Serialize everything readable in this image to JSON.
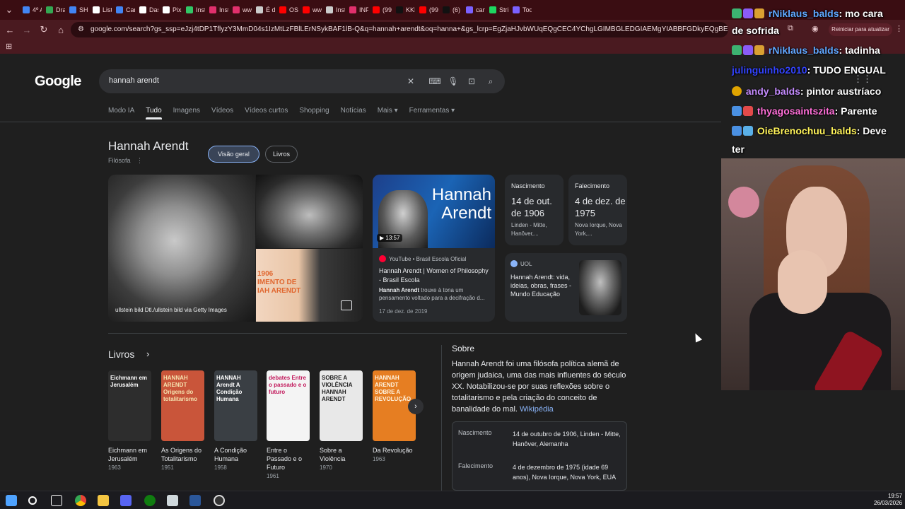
{
  "browser": {
    "tabs": [
      "4º A",
      "Dra",
      "SHI",
      "Listi",
      "Can",
      "Das",
      "Pix",
      "Inst",
      "Inst",
      "ww",
      "É di",
      "OS",
      "ww",
      "Inst",
      "INF",
      "(99",
      "KKI",
      "(99",
      "(6)",
      "can",
      "Stri",
      "Tod"
    ],
    "tab_colors": [
      "#4285f4",
      "#34a853",
      "#4285f4",
      "#ffffff",
      "#4285f4",
      "#ffffff",
      "#ffffff",
      "#32c766",
      "#e1306c",
      "#e1306c",
      "#cccccc",
      "#ff0000",
      "#ff0000",
      "#cccccc",
      "#e1306c",
      "#ff0000",
      "#111111",
      "#ff0000",
      "#111111",
      "#7b61ff",
      "#1ed760",
      "#7b61ff"
    ],
    "url": "google.com/search?gs_ssp=eJzj4tDP1TflyzY3MmD04s1IzMtLzFBlLErNSykBAF1lB-Q&q=hannah+arendt&oq=hanna+&gs_lcrp=EgZjaHJvbWUqEQgCEC4YChgLGIMBGLEDGIAEMgYIABBFGDkyEQgBEC4YChgLGIMBGLEDE...",
    "restart_label": "Reiniciar para atualizar"
  },
  "search": {
    "logo": "Google",
    "query": "hannah arendt",
    "tabs": [
      "Modo IA",
      "Tudo",
      "Imagens",
      "Vídeos",
      "Vídeos curtos",
      "Shopping",
      "Notícias",
      "Mais ▾",
      "Ferramentas ▾"
    ]
  },
  "knowledge_panel": {
    "title": "Hannah Arendt",
    "subtitle": "Filósofa",
    "chips": [
      "Visão geral",
      "Livros"
    ],
    "photo_credit": "ullstein bild Dtl./ullstein bild via Getty Images",
    "photo_overlay": "1906\nIMENTO DE\nIAH ARENDT",
    "video": {
      "thumb_text": "Hannah\nArendt",
      "duration": "▶ 13:57",
      "source": "YouTube • Brasil Escola Oficial",
      "title": "Hannah Arendt | Women of Philosophy - Brasil Escola",
      "desc_bold": "Hannah Arendt",
      "desc": " trouxe à tona um pensamento voltado para a decifração d...",
      "date": "17 de dez. de 2019"
    },
    "birth": {
      "label": "Nascimento",
      "date": "14 de out. de 1906",
      "place": "Linden - Mitte, Hanôver,..."
    },
    "death": {
      "label": "Falecimento",
      "date": "4 de dez. de 1975",
      "place": "Nova Iorque, Nova York,..."
    },
    "uol": {
      "source": "UOL",
      "title": "Hannah Arendt: vida, ideias, obras, frases - Mundo Educação"
    },
    "books_heading": "Livros",
    "books": [
      {
        "title": "Eichmann em Jerusalém",
        "year": "1963",
        "cover_text": "Eichmann em Jerusalém",
        "color": "#2d2d2d",
        "text_color": "#ffffff"
      },
      {
        "title": "As Origens do Totalitarismo",
        "year": "1951",
        "cover_text": "HANNAH ARENDT Origens do totalitarismo",
        "color": "#c9553a",
        "text_color": "#f5e3b0"
      },
      {
        "title": "A Condição Humana",
        "year": "1958",
        "cover_text": "HANNAH Arendt A Condição Humana",
        "color": "#3a3f44",
        "text_color": "#ffffff"
      },
      {
        "title": "Entre o Passado e o Futuro",
        "year": "1961",
        "cover_text": "debates Entre o passado e o futuro",
        "color": "#f4f4f4",
        "text_color": "#c2185b"
      },
      {
        "title": "Sobre a Violência",
        "year": "1970",
        "cover_text": "SOBRE A VIOLÊNCIA HANNAH ARENDT",
        "color": "#e8e8e8",
        "text_color": "#222222"
      },
      {
        "title": "Da Revolução",
        "year": "1963",
        "cover_text": "HANNAH ARENDT SOBRE A REVOLUÇÃO",
        "color": "#e67e22",
        "text_color": "#fff4e0"
      }
    ],
    "about_heading": "Sobre",
    "about_text": "Hannah Arendt foi uma filósofa política alemã de origem judaica, uma das mais influentes do século XX. Notabilizou-se por suas reflexões sobre o totalitarismo e pela criação do conceito de banalidade do mal. ",
    "about_link": "Wikipédia",
    "facts": [
      {
        "k": "Nascimento",
        "v": "14 de outubro de 1906, Linden - Mitte, Hanôver, Alemanha"
      },
      {
        "k": "Falecimento",
        "v": "4 de dezembro de 1975 (idade 69 anos), Nova Iorque, Nova York, EUA"
      }
    ]
  },
  "chat": [
    {
      "user": "rNiklaus_balds",
      "user_color": "#5fa8ff",
      "text": ": mo cara",
      "cont": "de sofrida"
    },
    {
      "user": "rNiklaus_balds",
      "user_color": "#5fa8ff",
      "text": ": tadinha",
      "cont": ""
    },
    {
      "user": "julinguinho2010",
      "user_color": "#3344ff",
      "text": ": TUDO ENGUAL",
      "cont": ""
    },
    {
      "user": "andy_balds",
      "user_color": "#c58cff",
      "text": ": pintor austríaco",
      "cont": ""
    },
    {
      "user": "thyagosaintszita",
      "user_color": "#ff6fd8",
      "text": ": Parente",
      "cont": ""
    },
    {
      "user": "OieBrenochuu_balds",
      "user_color": "#fff35a",
      "text": ": Deve",
      "cont": "ter"
    }
  ],
  "taskbar": {
    "time": "19:57",
    "date": "26/03/2026"
  }
}
